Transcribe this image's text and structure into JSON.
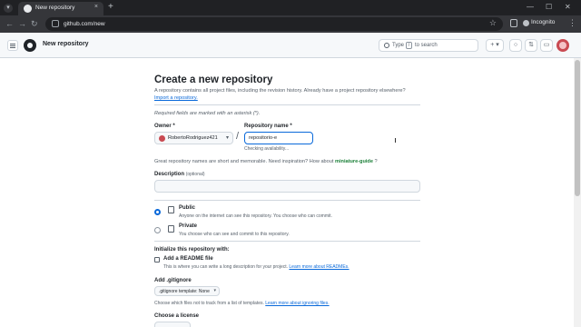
{
  "browser": {
    "tab_title": "New repository",
    "tab_close": "×",
    "new_tab": "+",
    "url": "github.com/new",
    "incognito_label": "Incognito",
    "nav_back": "←",
    "nav_forward": "→",
    "nav_reload": "↻",
    "star": "☆",
    "menu": "⋮",
    "minimize": "—",
    "maximize": "☐",
    "close": "✕"
  },
  "header": {
    "title": "New repository",
    "search_pre": "Type",
    "search_key": "/",
    "search_post": "to search",
    "plus_label": "+ ▾"
  },
  "page": {
    "heading": "Create a new repository",
    "description": "A repository contains all project files, including the revision history. Already have a project repository elsewhere?",
    "import_link": "Import a repository.",
    "required_note": "Required fields are marked with an asterisk (*)."
  },
  "form": {
    "owner_label": "Owner *",
    "owner_value": "RobertoRodriguez421",
    "slash": "/",
    "repo_label": "Repository name *",
    "repo_value": "repositorio-e",
    "checking": "Checking availability...",
    "suggest_text": "Great repository names are short and memorable. Need inspiration? How about",
    "suggest_name": "miniature-guide",
    "suggest_end": "?",
    "desc_label": "Description",
    "desc_optional": "(optional)"
  },
  "visibility": {
    "public_title": "Public",
    "public_desc": "Anyone on the internet can see this repository. You choose who can commit.",
    "private_title": "Private",
    "private_desc": "You choose who can see and commit to this repository."
  },
  "init": {
    "title": "Initialize this repository with:",
    "readme_label": "Add a README file",
    "readme_desc": "This is where you can write a long description for your project.",
    "readme_link": "Learn more about READMEs.",
    "gitignore_title": "Add .gitignore",
    "gitignore_value": ".gitignore template: None",
    "gitignore_desc": "Choose which files not to track from a list of templates.",
    "gitignore_link": "Learn more about ignoring files.",
    "license_title": "Choose a license"
  },
  "colors": {
    "primary_link": "#0969da",
    "suggestion": "#1a7f37",
    "chrome_dark": "#202124"
  }
}
